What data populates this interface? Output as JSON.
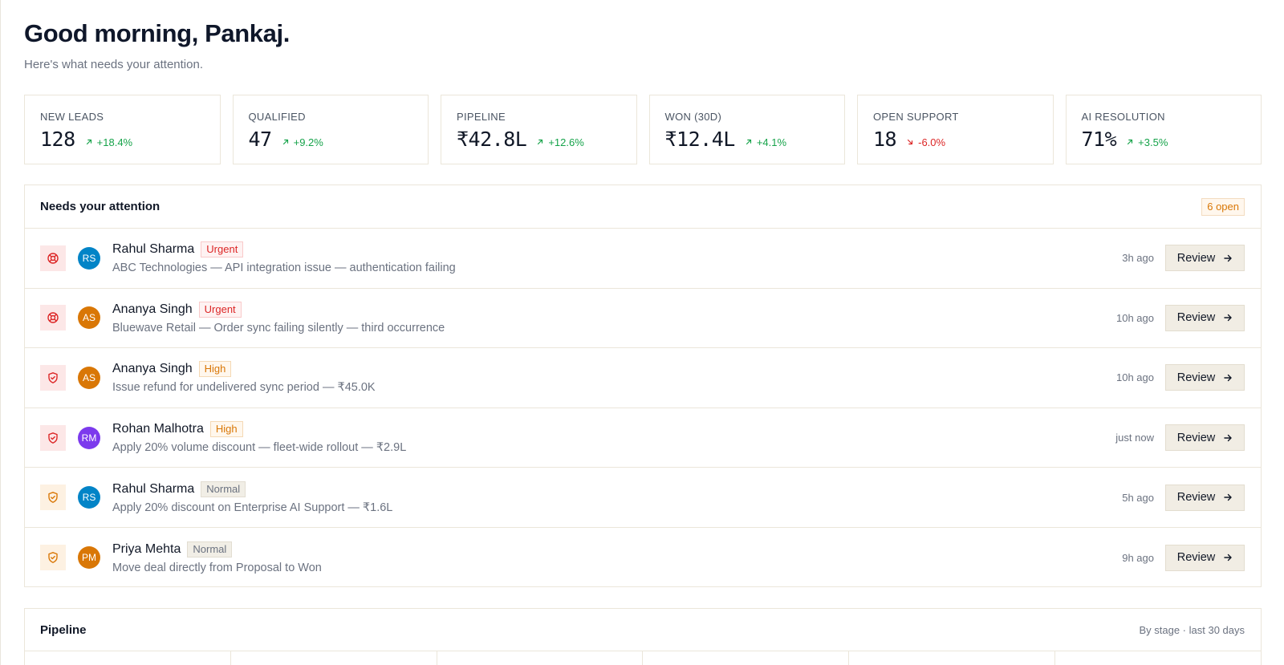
{
  "header": {
    "greeting": "Good morning, Pankaj.",
    "subtitle": "Here's what needs your attention."
  },
  "stats": [
    {
      "label": "New Leads",
      "value": "128",
      "delta": "+18.4%",
      "trend": "up"
    },
    {
      "label": "Qualified",
      "value": "47",
      "delta": "+9.2%",
      "trend": "up"
    },
    {
      "label": "Pipeline",
      "value": "₹42.8L",
      "delta": "+12.6%",
      "trend": "up"
    },
    {
      "label": "Won (30D)",
      "value": "₹12.4L",
      "delta": "+4.1%",
      "trend": "up"
    },
    {
      "label": "Open Support",
      "value": "18",
      "delta": "-6.0%",
      "trend": "down"
    },
    {
      "label": "AI Resolution",
      "value": "71%",
      "delta": "+3.5%",
      "trend": "up"
    }
  ],
  "attention": {
    "title": "Needs your attention",
    "badge": "6 open",
    "review_label": "Review",
    "items": [
      {
        "icon": "lifebuoy-icon",
        "tone": "red",
        "initials": "RS",
        "avatar_color": "#0284c7",
        "name": "Rahul Sharma",
        "priority": "Urgent",
        "priority_level": "urgent",
        "description": "ABC Technologies — API integration issue — authentication failing",
        "time": "3h ago"
      },
      {
        "icon": "lifebuoy-icon",
        "tone": "red",
        "initials": "AS",
        "avatar_color": "#d97706",
        "name": "Ananya Singh",
        "priority": "Urgent",
        "priority_level": "urgent",
        "description": "Bluewave Retail — Order sync failing silently — third occurrence",
        "time": "10h ago"
      },
      {
        "icon": "shield-check-icon",
        "tone": "red",
        "initials": "AS",
        "avatar_color": "#d97706",
        "name": "Ananya Singh",
        "priority": "High",
        "priority_level": "high",
        "description": "Issue refund for undelivered sync period — ₹45.0K",
        "time": "10h ago"
      },
      {
        "icon": "shield-check-icon",
        "tone": "red",
        "initials": "RM",
        "avatar_color": "#7c3aed",
        "name": "Rohan Malhotra",
        "priority": "High",
        "priority_level": "high",
        "description": "Apply 20% volume discount — fleet-wide rollout — ₹2.9L",
        "time": "just now"
      },
      {
        "icon": "shield-check-icon",
        "tone": "amber",
        "initials": "RS",
        "avatar_color": "#0284c7",
        "name": "Rahul Sharma",
        "priority": "Normal",
        "priority_level": "normal",
        "description": "Apply 20% discount on Enterprise AI Support — ₹1.6L",
        "time": "5h ago"
      },
      {
        "icon": "shield-check-icon",
        "tone": "amber",
        "initials": "PM",
        "avatar_color": "#d97706",
        "name": "Priya Mehta",
        "priority": "Normal",
        "priority_level": "normal",
        "description": "Move deal directly from Proposal to Won",
        "time": "9h ago"
      }
    ]
  },
  "pipeline": {
    "title": "Pipeline",
    "meta": "By stage · last 30 days"
  }
}
